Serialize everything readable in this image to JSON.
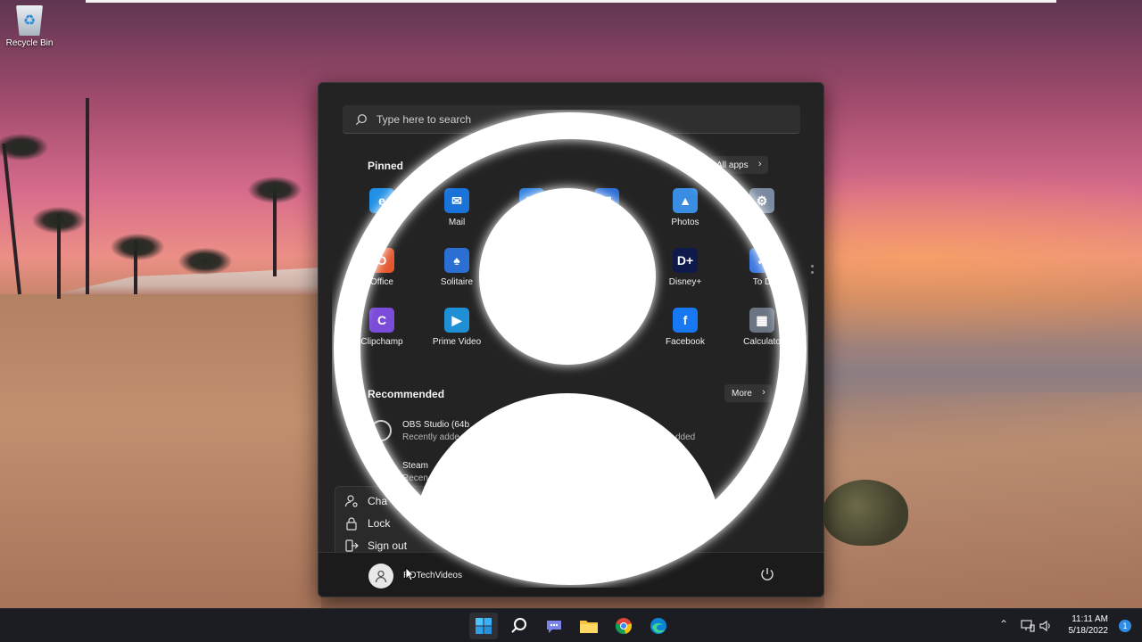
{
  "desktop": {
    "recycle_bin_label": "Recycle Bin"
  },
  "start_menu": {
    "search_placeholder": "Type here to search",
    "pinned_title": "Pinned",
    "all_apps_label": "All apps",
    "pinned_apps": [
      {
        "name": "",
        "icon": "edge-icon",
        "color": "#1f8fe5"
      },
      {
        "name": "Mail",
        "icon": "mail-icon",
        "color": "#1a73d9"
      },
      {
        "name": "",
        "icon": "calendar-icon",
        "color": "#2d7fe0"
      },
      {
        "name": "e",
        "icon": "store-icon",
        "color": "#2b6cd6"
      },
      {
        "name": "Photos",
        "icon": "photos-icon",
        "color": "#3a8de3"
      },
      {
        "name": "gs",
        "icon": "settings-icon",
        "color": "#7a8aa0"
      },
      {
        "name": "Office",
        "icon": "office-icon",
        "color": "#e4572e"
      },
      {
        "name": "Solitaire",
        "icon": "solitaire-icon",
        "color": "#2a6fd1"
      },
      {
        "name": "Disney+",
        "icon": "disney-plus-icon",
        "color": "#0e1a4a"
      },
      {
        "name": "To D",
        "icon": "todo-icon",
        "color": "#3b75e0"
      },
      {
        "name": "Clipchamp",
        "icon": "clipchamp-icon",
        "color": "#7b4bd9"
      },
      {
        "name": "Prime Video",
        "icon": "prime-video-icon",
        "color": "#1f8fd6"
      },
      {
        "name": "h",
        "icon": "unknown-icon",
        "color": "#444"
      },
      {
        "name": "Facebook",
        "icon": "facebook-icon",
        "color": "#1877f2"
      },
      {
        "name": "Calculato",
        "icon": "calculator-icon",
        "color": "#6a7482"
      }
    ],
    "recommended_title": "Recommended",
    "more_label": "More",
    "recommended": [
      {
        "title": "OBS Studio (64b",
        "subtitle": "Recently adde"
      },
      {
        "title": "Steam",
        "subtitle": "Recen"
      }
    ],
    "recent_added_right": "dded",
    "user_menu": {
      "change_label": "Cha",
      "lock_label": "Lock",
      "sign_out_label": "Sign out"
    },
    "user_name": "RDTechVideos"
  },
  "taskbar": {
    "time": "11:11 AM",
    "date": "5/18/2022",
    "notification_count": "1"
  },
  "colors": {
    "accent": "#2f8de4",
    "menu_bg": "#232323"
  }
}
